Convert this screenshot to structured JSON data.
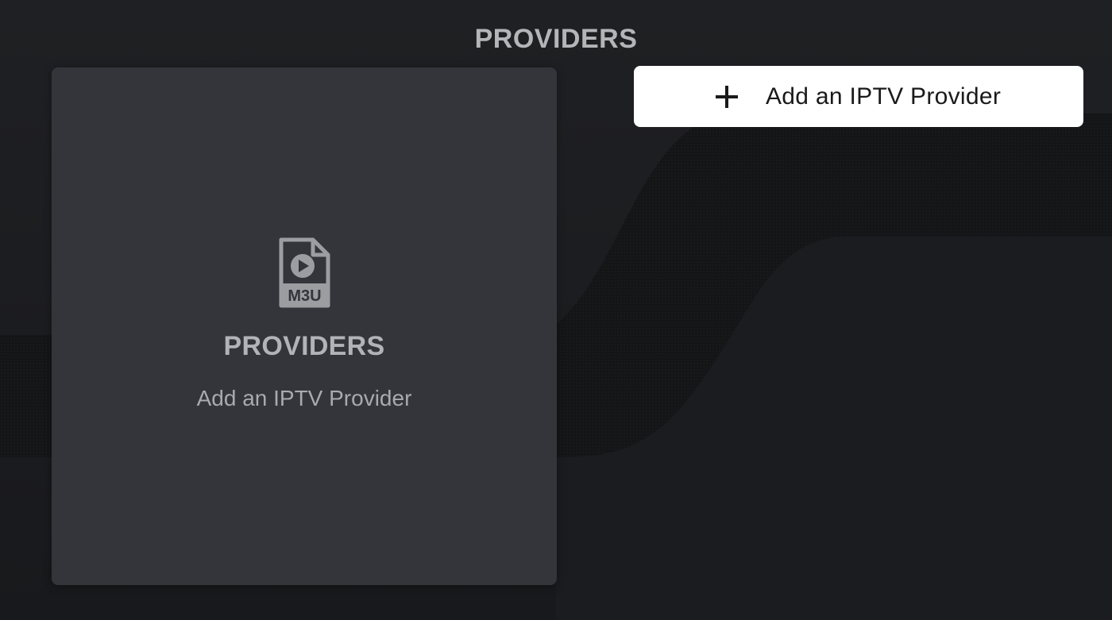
{
  "header": {
    "title": "PROVIDERS"
  },
  "card": {
    "icon": "m3u-file-play-icon",
    "icon_text": "M3U",
    "title": "PROVIDERS",
    "subtitle": "Add an IPTV Provider"
  },
  "add_button": {
    "icon": "plus-icon",
    "label": "Add an IPTV Provider"
  },
  "colors": {
    "background": "#1b1c1f",
    "card": "#33353b",
    "button": "#ffffff",
    "text_muted": "#b2b3b6"
  }
}
